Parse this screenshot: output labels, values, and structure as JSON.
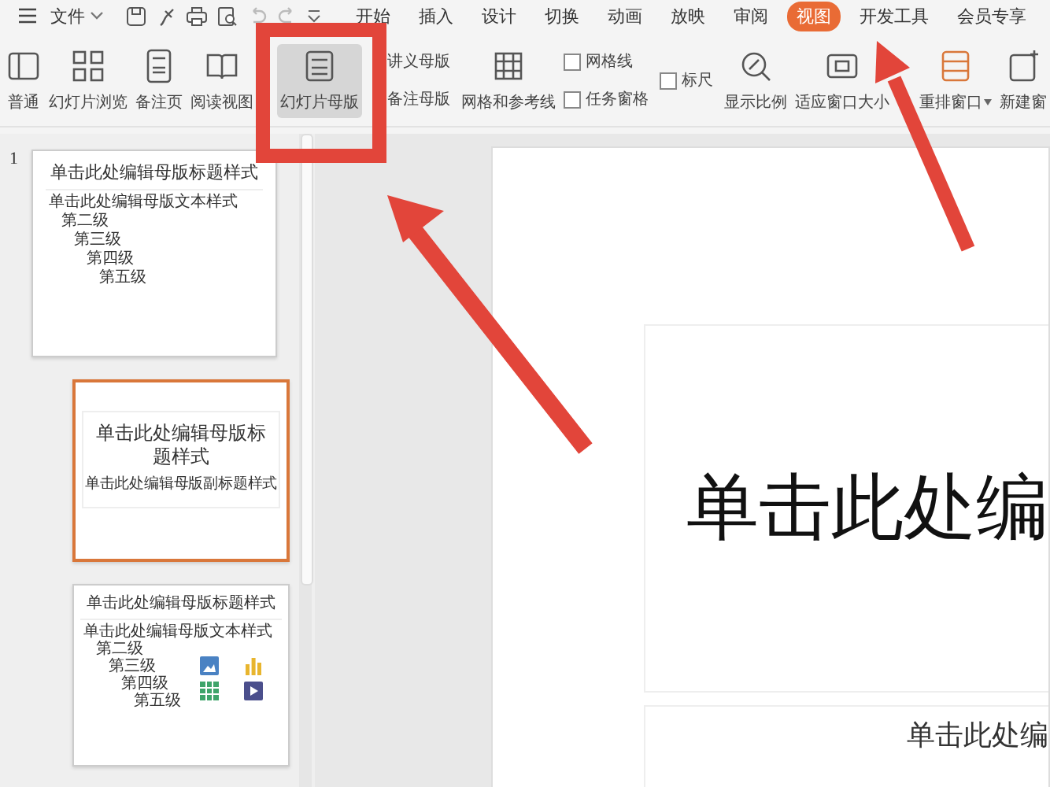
{
  "menu": {
    "label": "文件"
  },
  "tabs": [
    {
      "label": "开始",
      "selected": false
    },
    {
      "label": "插入",
      "selected": false
    },
    {
      "label": "设计",
      "selected": false
    },
    {
      "label": "切换",
      "selected": false
    },
    {
      "label": "动画",
      "selected": false
    },
    {
      "label": "放映",
      "selected": false
    },
    {
      "label": "审阅",
      "selected": false
    },
    {
      "label": "视图",
      "selected": true
    },
    {
      "label": "开发工具",
      "selected": false
    },
    {
      "label": "会员专享",
      "selected": false
    }
  ],
  "ribbon": [
    {
      "kind": "large",
      "label": "普通",
      "selected": false
    },
    {
      "kind": "large",
      "label": "幻灯片浏览",
      "selected": false
    },
    {
      "kind": "large",
      "label": "备注页",
      "selected": false
    },
    {
      "kind": "large",
      "label": "阅读视图",
      "selected": false
    },
    {
      "kind": "large",
      "label": "幻灯片母版",
      "selected": true
    },
    {
      "kind": "stack",
      "items": [
        {
          "kind": "small",
          "label": "讲义母版"
        },
        {
          "kind": "small",
          "label": "备注母版"
        }
      ]
    },
    {
      "kind": "large",
      "label": "网格和参考线",
      "selected": false
    },
    {
      "kind": "stack",
      "items": [
        {
          "kind": "check",
          "label": "网格线",
          "checked": false
        },
        {
          "kind": "check",
          "label": "任务窗格",
          "checked": false
        }
      ]
    },
    {
      "kind": "stack",
      "items": [
        {
          "kind": "check",
          "label": "标尺",
          "checked": false
        }
      ]
    },
    {
      "kind": "large",
      "label": "显示比例",
      "selected": false
    },
    {
      "kind": "large",
      "label": "适应窗口大小",
      "selected": false
    },
    {
      "kind": "large",
      "label": "重排窗口",
      "selected": false,
      "dropdown": true
    },
    {
      "kind": "large",
      "label": "新建窗",
      "selected": false
    }
  ],
  "thumbnails": [
    {
      "kind": "master",
      "number": "1",
      "selected": false,
      "title": "单击此处编辑母版标题样式",
      "levels": [
        "单击此处编辑母版文本样式",
        "第二级",
        "第三级",
        "第四级",
        "第五级"
      ]
    },
    {
      "kind": "title",
      "selected": true,
      "title": "单击此处编辑母版标题样式",
      "subtitle": "单击此处编辑母版副标题样式"
    },
    {
      "kind": "content",
      "selected": false,
      "title": "单击此处编辑母版标题样式",
      "levels": [
        "单击此处编辑母版文本样式",
        "第二级",
        "第三级",
        "第四级",
        "第五级"
      ]
    }
  ],
  "slide": {
    "title": "单击此处编",
    "subtitle": "单击此处编"
  }
}
